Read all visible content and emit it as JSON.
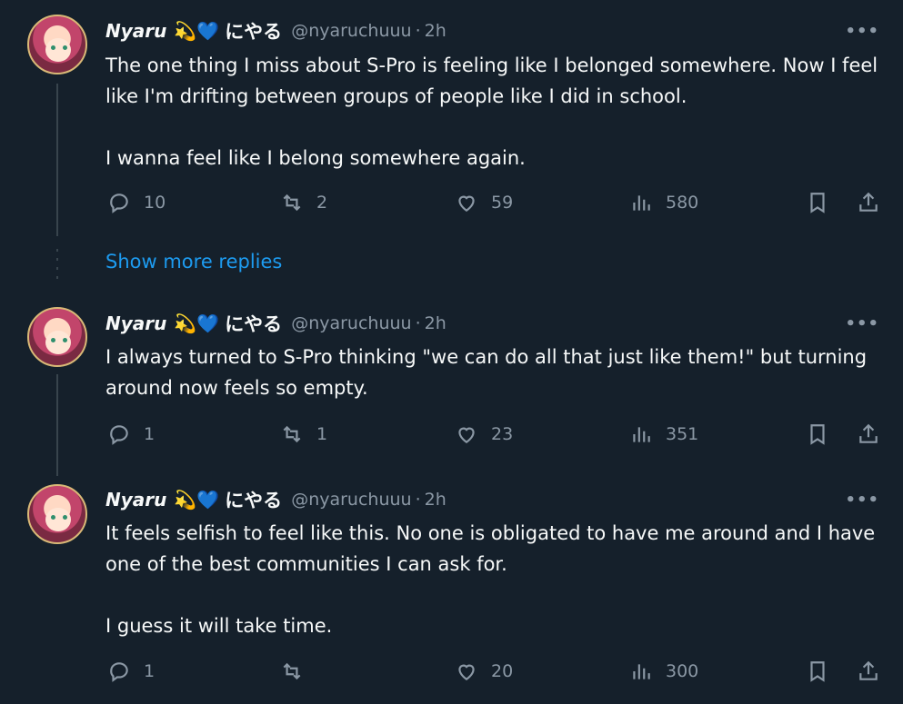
{
  "tweets": [
    {
      "name": "Nyaru",
      "emoji": "💫💙",
      "jp_name": "にやる",
      "handle": "@nyaruchuuu",
      "time": "2h",
      "more": "•••",
      "paragraphs": [
        "The one thing I miss about S-Pro is feeling like I belonged somewhere. Now I feel like I'm drifting between groups of people like I did in school.",
        "I wanna feel like I belong somewhere again."
      ],
      "replies": "10",
      "retweets": "2",
      "likes": "59",
      "views": "580"
    },
    {
      "name": "Nyaru",
      "emoji": "💫💙",
      "jp_name": "にやる",
      "handle": "@nyaruchuuu",
      "time": "2h",
      "more": "•••",
      "paragraphs": [
        "I always turned to S-Pro thinking \"we can do all that just like them!\" but turning around now feels so empty."
      ],
      "replies": "1",
      "retweets": "1",
      "likes": "23",
      "views": "351"
    },
    {
      "name": "Nyaru",
      "emoji": "💫💙",
      "jp_name": "にやる",
      "handle": "@nyaruchuuu",
      "time": "2h",
      "more": "•••",
      "paragraphs": [
        "It feels selfish to feel like this. No one is obligated to have me around and I have one of the best communities I can ask for.",
        "I guess it will take time."
      ],
      "replies": "1",
      "retweets": "",
      "likes": "20",
      "views": "300"
    }
  ],
  "show_more_replies": "Show more replies",
  "colors": {
    "background": "#15202b",
    "text": "#f7f9f9",
    "secondary": "#8b98a5",
    "link": "#1d9bf0",
    "line": "#38444d"
  },
  "icons": [
    "reply-icon",
    "retweet-icon",
    "like-icon",
    "views-icon",
    "bookmark-icon",
    "share-icon",
    "more-icon"
  ]
}
